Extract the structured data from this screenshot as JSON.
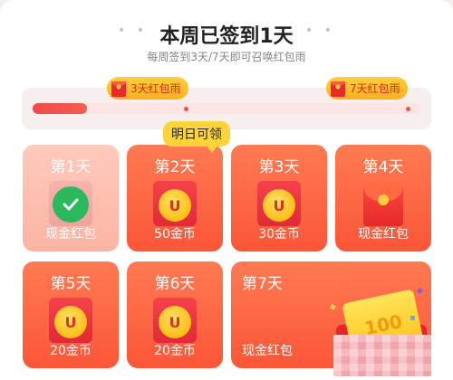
{
  "header": {
    "title": "本周已签到1天",
    "subtitle": "每周签到3天/7天即可召唤红包雨",
    "dots_left": "• •",
    "dots_right": "• •"
  },
  "progress": {
    "signed_days": 1,
    "total_days": 7,
    "fill_fraction": 0.14,
    "milestones": [
      {
        "label": "3天红包雨"
      },
      {
        "label": "7天红包雨"
      }
    ]
  },
  "tooltip": {
    "label": "明日可领"
  },
  "days": [
    {
      "day": "第1天",
      "reward": "现金红包",
      "state": "done",
      "icon": "check-icon"
    },
    {
      "day": "第2天",
      "reward": "50金币",
      "state": "next",
      "icon": "coin-icon"
    },
    {
      "day": "第3天",
      "reward": "30金币",
      "state": "locked",
      "icon": "coin-icon"
    },
    {
      "day": "第4天",
      "reward": "现金红包",
      "state": "locked",
      "icon": "red-envelope-icon"
    },
    {
      "day": "第5天",
      "reward": "20金币",
      "state": "locked",
      "icon": "coin-icon"
    },
    {
      "day": "第6天",
      "reward": "20金币",
      "state": "locked",
      "icon": "coin-icon"
    },
    {
      "day": "第7天",
      "reward": "现金红包",
      "state": "locked",
      "icon": "gift-bag-icon",
      "prize_text": "100"
    }
  ],
  "coin_glyph": "U",
  "colors": {
    "accent_red": "#fb5638",
    "card_done": "#fbb4a3",
    "milestone_yellow": "#ffc21f",
    "check_green": "#2cb85c"
  }
}
